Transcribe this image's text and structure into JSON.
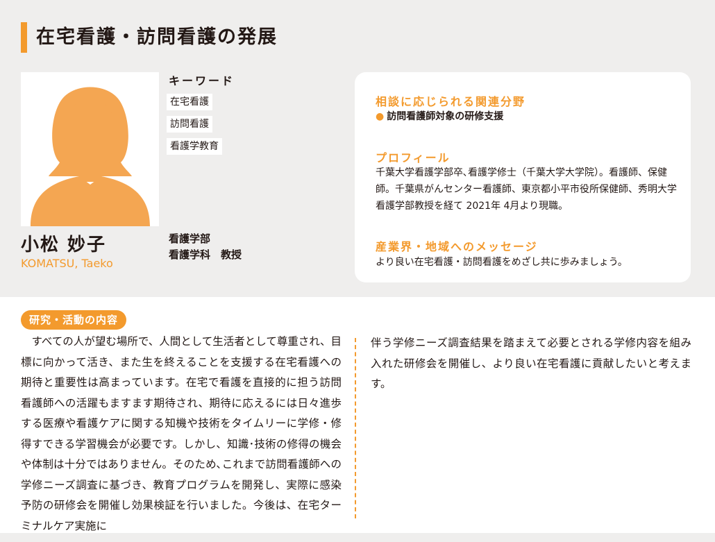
{
  "page_title": "在宅看護・訪問看護の発展",
  "keywords": {
    "heading": "キーワード",
    "items": [
      "在宅看護",
      "訪問看護",
      "看護学教育"
    ]
  },
  "person": {
    "name_jp": "小松 妙子",
    "name_en": "KOMATSU, Taeko",
    "faculty": "看護学部",
    "department_position": "看護学科　教授"
  },
  "consult": {
    "heading": "相談に応じられる関連分野",
    "items": [
      "訪問看護師対象の研修支援"
    ]
  },
  "profile": {
    "heading": "プロフィール",
    "text": "千葉大学看護学部卒､看護学修士（千葉大学大学院）。看護師、保健師。千葉県がんセンター看護師、東京都小平市役所保健師、秀明大学看護学部教授を経て 2021年 4月より現職。"
  },
  "message": {
    "heading": "産業界・地域へのメッセージ",
    "text": "より良い在宅看護・訪問看護をめざし共に歩みましょう。"
  },
  "research": {
    "tab_label": "研究・活動の内容",
    "text_left": "すべての人が望む場所で、人間として生活者として尊重され、目標に向かって活き、また生を終えることを支援する在宅看護への期待と重要性は高まっています。在宅で看護を直接的に担う訪問看護師への活躍もますます期待され、期待に応えるには日々進歩する医療や看護ケアに関する知機や技術をタイムリーに学修・修得すできる学習機会が必要です。しかし、知識･技術の修得の機会や体制は十分ではありません。そのため､これまで訪問看護師への学修ニーズ調査に基づき、教育プログラムを開発し、実際に感染予防の研修会を開催し効果検証を行いました。今後は、在宅ターミナルケア実施に",
    "text_right": "伴う学修ニーズ調査結果を踏まえて必要とされる学修内容を組み入れた研修会を開催し、より良い在宅看護に貢献したいと考えます。"
  },
  "colors": {
    "accent": "#f39a2d",
    "panel": "#efeeed",
    "text": "#231815"
  },
  "icons": {
    "photo": "person-silhouette",
    "bullet": "dot"
  }
}
